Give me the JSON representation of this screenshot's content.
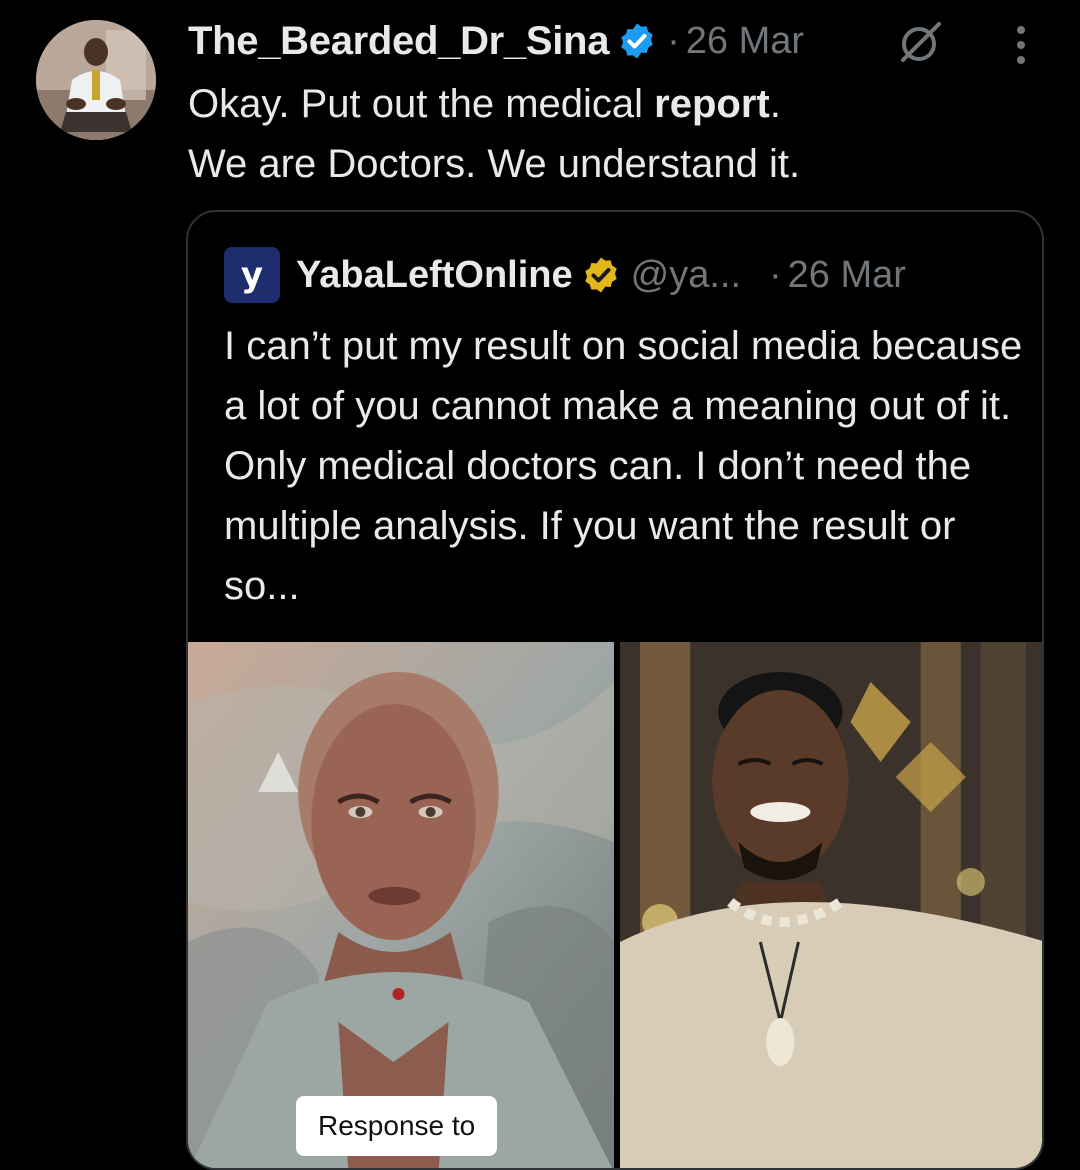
{
  "tweet": {
    "author_name": "The_Bearded_Dr_Sina",
    "separator": "·",
    "date": "26 Mar",
    "text_before": "Okay. Put out the medical ",
    "text_bold": "report",
    "text_after": ".",
    "text_line2": "We are Doctors. We understand it.",
    "avatar_icon": "person-avatar",
    "verified_icon": "blue-verified-badge",
    "grok_icon": "grok-icon",
    "more_icon": "more-vertical-icon"
  },
  "quote": {
    "logo_letter": "y",
    "name": "YabaLeftOnline",
    "handle": "@ya...",
    "separator": "·",
    "date": "26 Mar",
    "verified_icon": "gold-verified-badge",
    "text": "I can’t put my result on social media because a lot of you cannot make a meaning out of it. Only medical doctors can. I don’t need the multiple analysis. If you want the result or so...",
    "media": {
      "left_image": "photo-woman-bald-head",
      "right_image": "photo-man-smiling-shell-necklace",
      "badge_text": "Response to"
    }
  },
  "colors": {
    "background": "#000000",
    "text_primary": "#e7e9ea",
    "text_secondary": "#71767b",
    "border": "#2f3336",
    "verified_blue": "#1d9bf0",
    "verified_gold": "#e2b719",
    "logo_bg": "#1e2d6e"
  }
}
